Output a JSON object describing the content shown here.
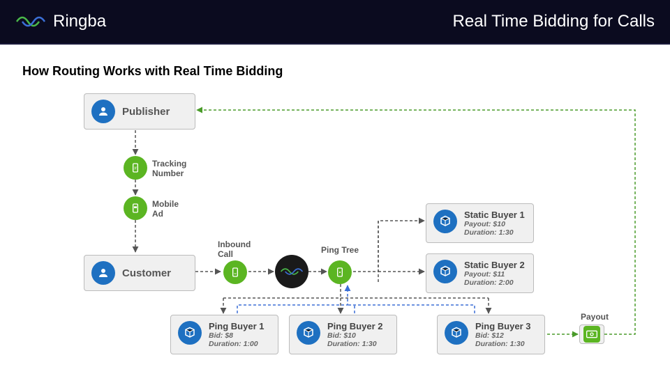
{
  "header": {
    "brand": "Ringba",
    "title": "Real Time Bidding for Calls"
  },
  "subtitle": "How Routing Works with Real Time Bidding",
  "nodes": {
    "publisher": "Publisher",
    "customer": "Customer",
    "tracking_number": "Tracking\nNumber",
    "mobile_ad": "Mobile\nAd",
    "inbound_call": "Inbound\nCall",
    "ping_tree": "Ping Tree",
    "static_buyer_1": {
      "title": "Static Buyer 1",
      "payout": "Payout: $10",
      "duration": "Duration: 1:30"
    },
    "static_buyer_2": {
      "title": "Static Buyer 2",
      "payout": "Payout: $11",
      "duration": "Duration: 2:00"
    },
    "ping_buyer_1": {
      "title": "Ping Buyer 1",
      "bid": "Bid: $8",
      "duration": "Duration: 1:00"
    },
    "ping_buyer_2": {
      "title": "Ping Buyer 2",
      "bid": "Bid: $10",
      "duration": "Duration: 1:30"
    },
    "ping_buyer_3": {
      "title": "Ping Buyer 3",
      "bid": "Bid: $12",
      "duration": "Duration: 1:30"
    },
    "payout_label": "Payout"
  }
}
